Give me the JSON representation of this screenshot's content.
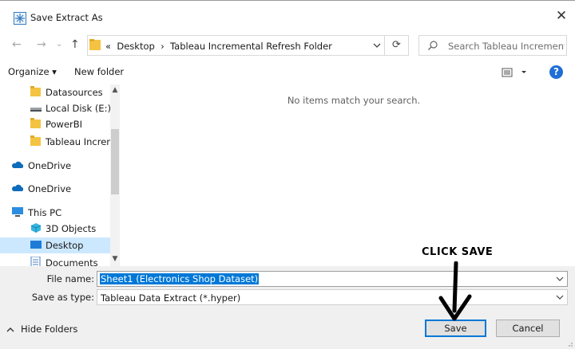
{
  "window": {
    "title": "Save Extract As",
    "close_glyph": "✕"
  },
  "nav": {
    "back_icon": "←",
    "forward_icon": "→",
    "recent_icon": "⌄",
    "up_icon": "↑",
    "breadcrumb_prefix": "«",
    "breadcrumb": [
      "Desktop",
      "Tableau Incremental Refresh Folder"
    ],
    "breadcrumb_sep": "›",
    "refresh_icon": "⟳",
    "search_placeholder": "Search Tableau Incremental ..."
  },
  "toolbar": {
    "organize": "Organize ▾",
    "new_folder": "New folder",
    "help": "?"
  },
  "sidebar": {
    "items": [
      {
        "label": "Datasources",
        "icon": "folder-icon"
      },
      {
        "label": "Local Disk (E:)",
        "icon": "drive-icon"
      },
      {
        "label": "PowerBI",
        "icon": "folder-icon"
      },
      {
        "label": "Tableau Increme",
        "icon": "folder-icon"
      },
      {
        "label": "OneDrive",
        "icon": "cloud-icon"
      },
      {
        "label": "OneDrive",
        "icon": "cloud-icon"
      },
      {
        "label": "This PC",
        "icon": "pc-icon"
      },
      {
        "label": "3D Objects",
        "icon": "cube-icon"
      },
      {
        "label": "Desktop",
        "icon": "desktop-icon",
        "selected": true
      },
      {
        "label": "Documents",
        "icon": "documents-icon"
      }
    ]
  },
  "main": {
    "empty_message": "No items match your search."
  },
  "form": {
    "file_name_label": "File name:",
    "file_name_value": "Sheet1 (Electronics Shop Dataset)",
    "save_type_label": "Save as type:",
    "save_type_value": "Tableau Data Extract (*.hyper)"
  },
  "footer": {
    "hide_folders": "Hide Folders",
    "save": "Save",
    "cancel": "Cancel"
  },
  "annotation": {
    "text": "CLICK SAVE"
  },
  "colors": {
    "accent": "#0078d7",
    "folder": "#f5c342",
    "help": "#1e6ed6",
    "selected_bg": "#cce8ff"
  }
}
